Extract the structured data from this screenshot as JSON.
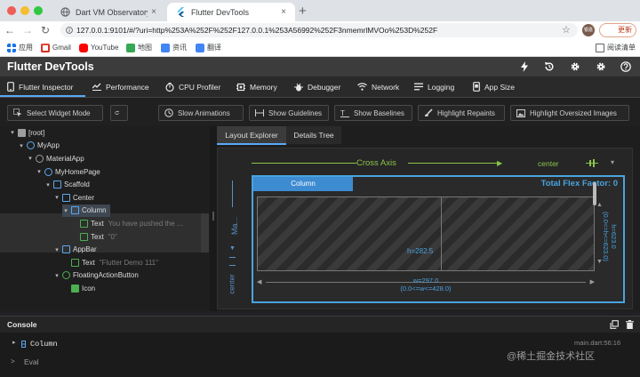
{
  "browser": {
    "tabs": [
      {
        "title": "Dart VM Observatory",
        "close": "×"
      },
      {
        "title": "Flutter DevTools",
        "close": "×"
      }
    ],
    "new_tab": "+",
    "url": "127.0.0.1:9101/#/?uri=http%253A%252F%252F127.0.0.1%253A56992%252F3nmemrlMVOo%253D%252F",
    "avatar_text": "银嘉",
    "update_label": "更新",
    "bookmarks": [
      {
        "label": "应用",
        "icon": "apps-icon",
        "color": "#1a73e8"
      },
      {
        "label": "Gmail",
        "icon": "gmail-icon",
        "color": "#d93025"
      },
      {
        "label": "YouTube",
        "icon": "youtube-icon",
        "color": "#ff0000"
      },
      {
        "label": "地图",
        "icon": "maps-icon",
        "color": "#34a853"
      },
      {
        "label": "资讯",
        "icon": "news-icon",
        "color": "#4285f4"
      },
      {
        "label": "翻译",
        "icon": "translate-icon",
        "color": "#4285f4"
      }
    ],
    "reading_list": "阅读清单"
  },
  "devtools": {
    "title": "Flutter DevTools",
    "nav_tabs": [
      {
        "label": "Flutter Inspector",
        "icon": "phone-icon"
      },
      {
        "label": "Performance",
        "icon": "performance-icon"
      },
      {
        "label": "CPU Profiler",
        "icon": "timer-icon"
      },
      {
        "label": "Memory",
        "icon": "memory-icon"
      },
      {
        "label": "Debugger",
        "icon": "debugger-icon"
      },
      {
        "label": "Network",
        "icon": "network-icon"
      },
      {
        "label": "Logging",
        "icon": "logging-icon"
      },
      {
        "label": "App Size",
        "icon": "app-size-icon"
      }
    ],
    "toolbar": {
      "select_widget_mode": "Select Widget Mode",
      "slow_animations": "Slow Animations",
      "show_guidelines": "Show Guidelines",
      "show_baselines": "Show Baselines",
      "highlight_repaints": "Highlight Repaints",
      "highlight_oversized_images": "Highlight Oversized Images"
    },
    "tree": [
      {
        "label": "[root]",
        "sub": "",
        "depth": 0,
        "caret": "▾",
        "icon": "folder-icon",
        "color": "#9e9e9e"
      },
      {
        "label": "MyApp",
        "sub": "",
        "depth": 1,
        "caret": "▾",
        "icon": "flutter-icon",
        "color": "#5aa9f0"
      },
      {
        "label": "MaterialApp",
        "sub": "",
        "depth": 2,
        "caret": "▾",
        "icon": "material-icon",
        "color": "#9e9e9e"
      },
      {
        "label": "MyHomePage",
        "sub": "",
        "depth": 3,
        "caret": "▾",
        "icon": "flutter-icon",
        "color": "#5aa9f0"
      },
      {
        "label": "Scaffold",
        "sub": "",
        "depth": 4,
        "caret": "▾",
        "icon": "scaffold-icon",
        "color": "#5aa9f0"
      },
      {
        "label": "Center",
        "sub": "",
        "depth": 5,
        "caret": "▾",
        "icon": "center-icon",
        "color": "#5aa9f0"
      },
      {
        "label": "Column",
        "sub": "",
        "depth": 6,
        "caret": "▾",
        "icon": "column-icon",
        "color": "#5aa9f0"
      },
      {
        "label": "Text",
        "sub": "You have pushed the ...",
        "depth": 7,
        "caret": "",
        "icon": "text-icon",
        "color": "#4caf50"
      },
      {
        "label": "Text",
        "sub": "\"0\"",
        "depth": 7,
        "caret": "",
        "icon": "text-icon",
        "color": "#4caf50"
      },
      {
        "label": "AppBar",
        "sub": "",
        "depth": 5,
        "caret": "▾",
        "icon": "appbar-icon",
        "color": "#5aa9f0"
      },
      {
        "label": "Text",
        "sub": "\"Flutter Demo 111\"",
        "depth": 6,
        "caret": "",
        "icon": "text-icon",
        "color": "#4caf50"
      },
      {
        "label": "FloatingActionButton",
        "sub": "",
        "depth": 5,
        "caret": "▾",
        "icon": "fab-icon",
        "color": "#4caf50"
      },
      {
        "label": "Icon",
        "sub": "",
        "depth": 6,
        "caret": "",
        "icon": "icon-widget-icon",
        "color": "#4caf50"
      }
    ],
    "right_tabs": [
      "Layout Explorer",
      "Details Tree"
    ],
    "layout": {
      "cross_axis": "Cross Axis",
      "cross_value": "center",
      "main_axis": "Ma...",
      "main_value": "center",
      "column_label": "Column",
      "total_flex": "Total Flex Factor: 0",
      "h_label": "h=282.5",
      "h_side": "h=623.0",
      "h_side2": "(0.0<=h<=623.0)",
      "w_label": "w=297.0",
      "w_label2": "(0.0<=w<=428.0)"
    },
    "console": {
      "title": "Console",
      "entry": "Column",
      "entry_source": "main.dart:56:16",
      "eval_label": "Eval",
      "eval_prompt": ">"
    },
    "watermark": "@稀土掘金技术社区"
  }
}
